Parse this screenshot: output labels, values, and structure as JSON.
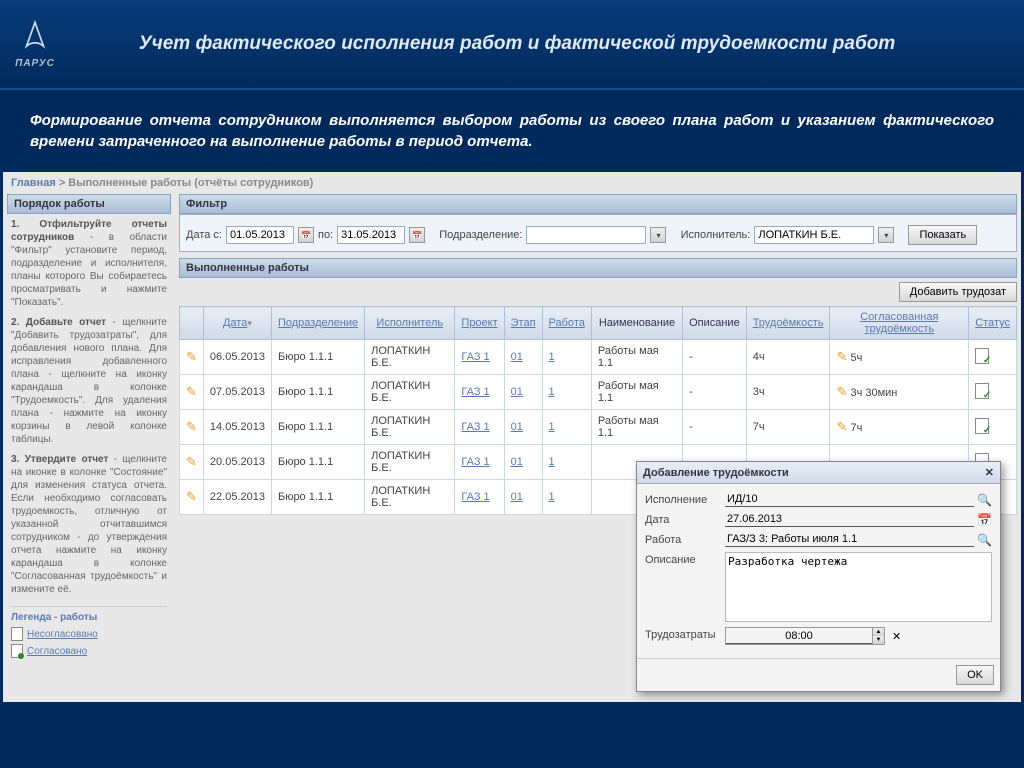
{
  "logo": "ПАРУС",
  "header_title": "Учет фактического исполнения работ и фактической трудоемкости работ",
  "subtitle": "Формирование отчета сотрудником выполняется выбором работы из своего плана работ и указанием фактического времени затраченного на выполнение работы в период отчета.",
  "breadcrumb": {
    "home": "Главная",
    "current": "Выполненные работы (отчёты сотрудников)"
  },
  "sidebar": {
    "title": "Порядок работы",
    "steps": [
      {
        "h": "1. Отфильтруйте отчеты сотрудников",
        "t": " - в области \"Фильтр\" установите период, подразделение и исполнителя, планы которого Вы собираетесь просматривать и нажмите \"Показать\"."
      },
      {
        "h": "2. Добавьте отчет",
        "t": " - щелкните \"Добавить трудозатраты\", для добавления нового плана. Для исправления добавленного плана - щелкните на иконку карандаша в колонке \"Трудоемкость\". Для удаления плана - нажмите на иконку корзины в левой колонке таблицы."
      },
      {
        "h": "3. Утвердите отчет",
        "t": " - щелкните на иконке в колонке \"Состояние\" для изменения статуса отчета. Если необходимо согласовать трудоемкость, отличную от указанной отчитавшимся сотрудником - до утверждения отчета нажмите на иконку карандаша в колонке \"Согласованная трудоёмкость\" и измените её."
      }
    ],
    "legend_title": "Легенда - работы",
    "legend": [
      "Несогласовано",
      "Согласовано"
    ]
  },
  "filter": {
    "title": "Фильтр",
    "date_from_label": "Дата с:",
    "date_from": "01.05.2013",
    "date_to_label": "по:",
    "date_to": "31.05.2013",
    "dept_label": "Подразделение:",
    "dept": "",
    "exec_label": "Исполнитель:",
    "exec": "ЛОПАТКИН Б.Е.",
    "show_btn": "Показать"
  },
  "section_title": "Выполненные работы",
  "add_btn": "Добавить трудозат",
  "columns": {
    "date": "Дата",
    "dept": "Подразделение",
    "exec": "Исполнитель",
    "project": "Проект",
    "stage": "Этап",
    "work": "Работа",
    "name": "Наименование",
    "desc": "Описание",
    "labor": "Трудоёмкость",
    "agreed": "Согласованная трудоёмкость",
    "status": "Статус"
  },
  "rows": [
    {
      "date": "06.05.2013",
      "dept": "Бюро 1.1.1",
      "exec": "ЛОПАТКИН Б.Е.",
      "project": "ГАЗ 1",
      "stage": "01",
      "work": "1",
      "name": "Работы мая 1.1",
      "desc": "-",
      "labor": "4ч",
      "agreed": "5ч"
    },
    {
      "date": "07.05.2013",
      "dept": "Бюро 1.1.1",
      "exec": "ЛОПАТКИН Б.Е.",
      "project": "ГАЗ 1",
      "stage": "01",
      "work": "1",
      "name": "Работы мая 1.1",
      "desc": "-",
      "labor": "3ч",
      "agreed": "3ч 30мин"
    },
    {
      "date": "14.05.2013",
      "dept": "Бюро 1.1.1",
      "exec": "ЛОПАТКИН Б.Е.",
      "project": "ГАЗ 1",
      "stage": "01",
      "work": "1",
      "name": "Работы мая 1.1",
      "desc": "-",
      "labor": "7ч",
      "agreed": "7ч"
    },
    {
      "date": "20.05.2013",
      "dept": "Бюро 1.1.1",
      "exec": "ЛОПАТКИН Б.Е.",
      "project": "ГАЗ 1",
      "stage": "01",
      "work": "1",
      "name": "",
      "desc": "",
      "labor": "",
      "agreed": ""
    },
    {
      "date": "22.05.2013",
      "dept": "Бюро 1.1.1",
      "exec": "ЛОПАТКИН Б.Е.",
      "project": "ГАЗ 1",
      "stage": "01",
      "work": "1",
      "name": "",
      "desc": "",
      "labor": "",
      "agreed": ""
    }
  ],
  "dialog": {
    "title": "Добавление трудоёмкости",
    "fields": {
      "exec_l": "Исполнение",
      "exec_v": "ИД/10",
      "date_l": "Дата",
      "date_v": "27.06.2013",
      "work_l": "Работа",
      "work_v": "ГАЗ/З 3: Работы июля 1.1",
      "desc_l": "Описание",
      "desc_v": "Разработка чертежа",
      "labor_l": "Трудозатраты",
      "labor_v": "08:00"
    },
    "ok": "OK"
  }
}
